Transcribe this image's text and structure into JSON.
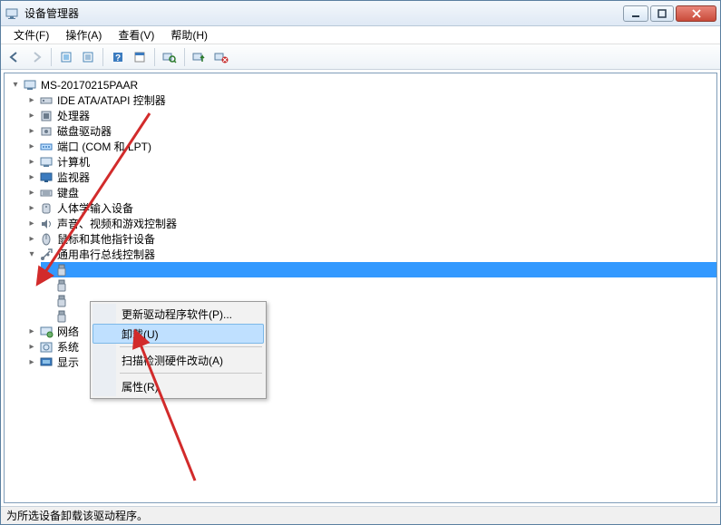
{
  "window": {
    "title": "设备管理器"
  },
  "menu": {
    "file": "文件(F)",
    "action": "操作(A)",
    "view": "查看(V)",
    "help": "帮助(H)"
  },
  "toolbar": {
    "back": "back",
    "forward": "forward",
    "show_hidden": "show-hidden",
    "details": "details",
    "help": "help",
    "properties": "properties",
    "scan": "scan",
    "update_driver": "update-driver",
    "uninstall": "uninstall"
  },
  "tree": {
    "root": "MS-20170215PAAR",
    "items": [
      {
        "label": "IDE ATA/ATAPI 控制器",
        "icon": "ide"
      },
      {
        "label": "处理器",
        "icon": "cpu"
      },
      {
        "label": "磁盘驱动器",
        "icon": "disk"
      },
      {
        "label": "端口 (COM 和 LPT)",
        "icon": "port"
      },
      {
        "label": "计算机",
        "icon": "computer"
      },
      {
        "label": "监视器",
        "icon": "monitor"
      },
      {
        "label": "键盘",
        "icon": "keyboard"
      },
      {
        "label": "人体学输入设备",
        "icon": "hid"
      },
      {
        "label": "声音、视频和游戏控制器",
        "icon": "sound"
      },
      {
        "label": "鼠标和其他指针设备",
        "icon": "mouse"
      },
      {
        "label": "通用串行总线控制器",
        "icon": "usb",
        "expanded": true
      },
      {
        "label": "网络",
        "icon": "network",
        "truncated": true
      },
      {
        "label": "系统",
        "icon": "system",
        "truncated": true
      },
      {
        "label": "显示",
        "icon": "display",
        "truncated": true
      }
    ],
    "usb_children_count": 4
  },
  "context_menu": {
    "update": "更新驱动程序软件(P)...",
    "uninstall": "卸载(U)",
    "scan": "扫描检测硬件改动(A)",
    "properties": "属性(R)"
  },
  "status": {
    "text": "为所选设备卸载该驱动程序。"
  },
  "colors": {
    "arrow": "#d22b2b"
  }
}
